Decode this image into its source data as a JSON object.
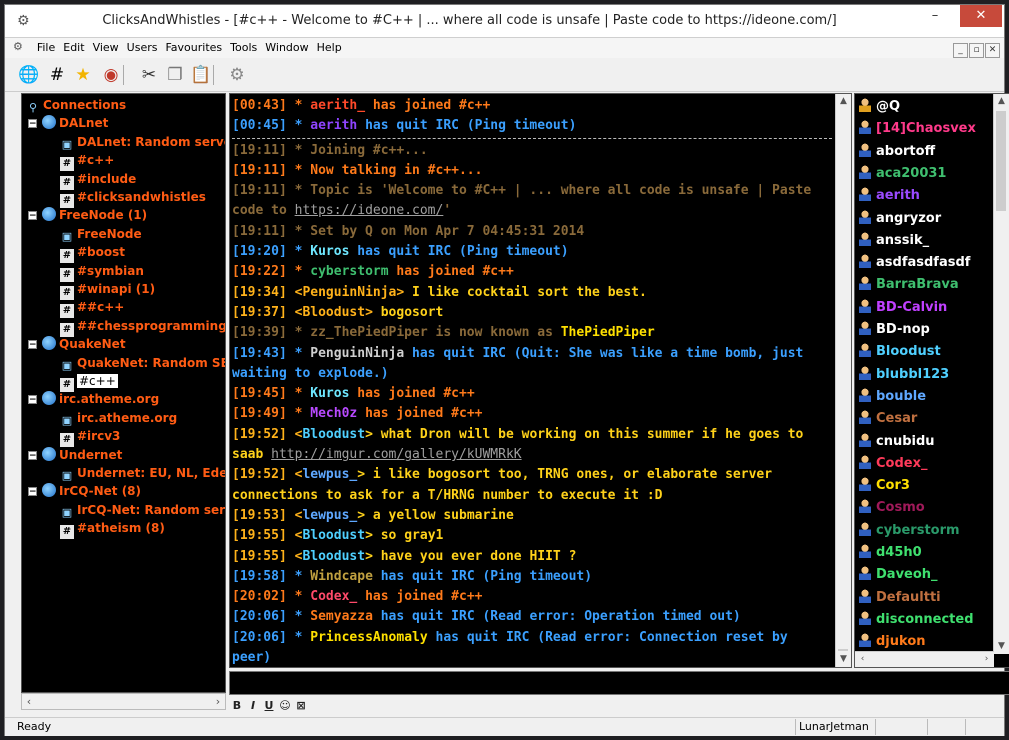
{
  "window": {
    "title": "ClicksAndWhistles - [#c++ - Welcome to #C++ | ... where all code is unsafe | Paste code to https://ideone.com/]",
    "min": "–",
    "max": "☐",
    "close": "✕"
  },
  "menu": [
    "File",
    "Edit",
    "View",
    "Users",
    "Favourites",
    "Tools",
    "Window",
    "Help"
  ],
  "toolbar": [
    {
      "icon": "globe-icon",
      "glyph": "🌐"
    },
    {
      "icon": "channel-icon",
      "glyph": "#"
    },
    {
      "icon": "star-icon",
      "glyph": "★"
    },
    {
      "icon": "disconnect-icon",
      "glyph": "◉"
    },
    {
      "icon": "cut-icon",
      "glyph": "✂"
    },
    {
      "icon": "copy-icon",
      "glyph": "❐"
    },
    {
      "icon": "paste-icon",
      "glyph": "📋"
    },
    {
      "icon": "settings-icon",
      "glyph": "⚙"
    }
  ],
  "tree": [
    {
      "label": "Connections",
      "type": "root",
      "level": 0
    },
    {
      "label": "DALnet",
      "type": "network",
      "level": 1
    },
    {
      "label": "DALnet: Random server",
      "type": "server",
      "level": 2
    },
    {
      "label": "#c++",
      "type": "channel",
      "level": 2
    },
    {
      "label": "#include",
      "type": "channel",
      "level": 2
    },
    {
      "label": "#clicksandwhistles",
      "type": "channel",
      "level": 2
    },
    {
      "label": "FreeNode (1)",
      "type": "network",
      "level": 1
    },
    {
      "label": "FreeNode",
      "type": "server",
      "level": 2
    },
    {
      "label": "#boost",
      "type": "channel",
      "level": 2
    },
    {
      "label": "#symbian",
      "type": "channel",
      "level": 2
    },
    {
      "label": "#winapi (1)",
      "type": "channel",
      "level": 2
    },
    {
      "label": "##c++",
      "type": "channel",
      "level": 2
    },
    {
      "label": "##chessprogramming",
      "type": "channel",
      "level": 2
    },
    {
      "label": "QuakeNet",
      "type": "network",
      "level": 1
    },
    {
      "label": "QuakeNet: Random SE server",
      "type": "server",
      "level": 2
    },
    {
      "label": "#c++",
      "type": "channel",
      "level": 2,
      "selected": true
    },
    {
      "label": "irc.atheme.org",
      "type": "network",
      "level": 1
    },
    {
      "label": "irc.atheme.org",
      "type": "server",
      "level": 2
    },
    {
      "label": "#ircv3",
      "type": "channel",
      "level": 2
    },
    {
      "label": "Undernet",
      "type": "network",
      "level": 1
    },
    {
      "label": "Undernet: EU, NL, Ede",
      "type": "server",
      "level": 2
    },
    {
      "label": "IrCQ-Net (8)",
      "type": "network",
      "level": 1
    },
    {
      "label": "IrCQ-Net: Random server",
      "type": "server",
      "level": 2
    },
    {
      "label": "#atheism (8)",
      "type": "channel",
      "level": 2
    }
  ],
  "chat": [
    {
      "parts": [
        [
          "[00:43] ",
          "#ff7a1a"
        ],
        [
          "* ",
          "#ff7a1a"
        ],
        [
          "aerith_",
          "#ff4a2a"
        ],
        [
          " has joined #c++",
          "#ff7a1a"
        ]
      ]
    },
    {
      "parts": [
        [
          "[00:45] ",
          "#3ba0ff"
        ],
        [
          "* ",
          "#3ba0ff"
        ],
        [
          "aerith",
          "#8e44ff"
        ],
        [
          " has quit IRC (Ping timeout)",
          "#3ba0ff"
        ]
      ]
    },
    {
      "divider": true
    },
    {
      "parts": [
        [
          "[19:11] * Joining #c++...",
          "#8a6a3a"
        ]
      ]
    },
    {
      "parts": [
        [
          "[19:11] * Now talking in #c++...",
          "#ff7a1a"
        ]
      ]
    },
    {
      "parts": [
        [
          "[19:11] * Topic is 'Welcome to #C++ | ... where all code is unsafe | Paste code to ",
          "#8a6a3a"
        ],
        [
          "https://ideone.com/",
          "#a0a0a0"
        ],
        [
          "'",
          "#8a6a3a"
        ]
      ]
    },
    {
      "parts": [
        [
          "[19:11] * Set by Q on Mon Apr 7 04:45:31 2014",
          "#8a6a3a"
        ]
      ]
    },
    {
      "parts": [
        [
          "[19:20] * ",
          "#3ba0ff"
        ],
        [
          "Kuros",
          "#6ee7ff"
        ],
        [
          " has quit IRC (Ping timeout)",
          "#3ba0ff"
        ]
      ]
    },
    {
      "parts": [
        [
          "[19:22] * ",
          "#ff7a1a"
        ],
        [
          "cyberstorm",
          "#3fbf6f"
        ],
        [
          " has joined #c++",
          "#ff7a1a"
        ]
      ]
    },
    {
      "parts": [
        [
          "[19:34] ",
          "#ffb21a"
        ],
        [
          "<PenguinNinja>",
          "#ffb21a"
        ],
        [
          " I like cocktail sort the best.",
          "#ffd21a"
        ]
      ]
    },
    {
      "parts": [
        [
          "[19:37] ",
          "#ffb21a"
        ],
        [
          "<Bloodust>",
          "#ffb21a"
        ],
        [
          " bogosort",
          "#ffd21a"
        ]
      ]
    },
    {
      "parts": [
        [
          "[19:39] * zz_ThePiedPiper is now known as ",
          "#8a6a3a"
        ],
        [
          "ThePiedPiper",
          "#ffe000"
        ]
      ]
    },
    {
      "parts": [
        [
          "[19:43] * ",
          "#3ba0ff"
        ],
        [
          "PenguinNinja",
          "#d0d0d0"
        ],
        [
          " has quit IRC (Quit: She was like a time bomb, just waiting to explode.)",
          "#3ba0ff"
        ]
      ]
    },
    {
      "parts": [
        [
          "[19:45] * ",
          "#ff7a1a"
        ],
        [
          "Kuros",
          "#6ee7ff"
        ],
        [
          " has joined #c++",
          "#ff7a1a"
        ]
      ]
    },
    {
      "parts": [
        [
          "[19:49] * ",
          "#ff7a1a"
        ],
        [
          "Mech0z",
          "#b84aff"
        ],
        [
          " has joined #c++",
          "#ff7a1a"
        ]
      ]
    },
    {
      "parts": [
        [
          "[19:52] ",
          "#ffb21a"
        ],
        [
          "<",
          "#ffb21a"
        ],
        [
          "Bloodust",
          "#4fd0ff"
        ],
        [
          "> what Dron will be working on this summer if he goes to saab ",
          "#ffd21a"
        ],
        [
          "http://imgur.com/gallery/kUWMRkK",
          "#a0a0a0"
        ]
      ]
    },
    {
      "parts": [
        [
          "[19:52] ",
          "#ffb21a"
        ],
        [
          "<",
          "#ffb21a"
        ],
        [
          "lewpus_",
          "#5fa8ff"
        ],
        [
          "> i like bogosort too, TRNG ones, or elaborate server connections to ask for a T/HRNG number to execute it :D",
          "#ffd21a"
        ]
      ]
    },
    {
      "parts": [
        [
          "[19:53] ",
          "#ffb21a"
        ],
        [
          "<",
          "#ffb21a"
        ],
        [
          "lewpus_",
          "#5fa8ff"
        ],
        [
          "> a yellow submarine",
          "#ffd21a"
        ]
      ]
    },
    {
      "parts": [
        [
          "[19:55] ",
          "#ffb21a"
        ],
        [
          "<",
          "#ffb21a"
        ],
        [
          "Bloodust",
          "#4fd0ff"
        ],
        [
          "> so gray1",
          "#ffd21a"
        ]
      ]
    },
    {
      "parts": [
        [
          "[19:55] ",
          "#ffb21a"
        ],
        [
          "<",
          "#ffb21a"
        ],
        [
          "Bloodust",
          "#4fd0ff"
        ],
        [
          "> have you ever done HIIT ?",
          "#ffd21a"
        ]
      ]
    },
    {
      "parts": [
        [
          "[19:58] * ",
          "#3ba0ff"
        ],
        [
          "Windcape",
          "#c0a040"
        ],
        [
          " has quit IRC (Ping timeout)",
          "#3ba0ff"
        ]
      ]
    },
    {
      "parts": [
        [
          "[20:02] * ",
          "#ff7a1a"
        ],
        [
          "Codex_",
          "#ff4a6a"
        ],
        [
          " has joined #c++",
          "#ff7a1a"
        ]
      ]
    },
    {
      "parts": [
        [
          "[20:06] * ",
          "#3ba0ff"
        ],
        [
          "Semyazza",
          "#ff7a1a"
        ],
        [
          " has quit IRC (Read error: Operation timed out)",
          "#3ba0ff"
        ]
      ]
    },
    {
      "parts": [
        [
          "[20:06] * ",
          "#3ba0ff"
        ],
        [
          "PrincessAnomaly",
          "#ffe000"
        ],
        [
          " has quit IRC (Read error: Connection reset by peer)",
          "#3ba0ff"
        ]
      ]
    },
    {
      "parts": [
        [
          "[20:07] * ",
          "#ff7a1a"
        ],
        [
          "Semyazza",
          "#ff7a1a"
        ],
        [
          " has joined #c++",
          "#ff7a1a"
        ]
      ]
    }
  ],
  "nicks": [
    {
      "name": "@Q",
      "color": "#ffffff",
      "op": true
    },
    {
      "name": "[14]Chaosvex",
      "color": "#ff3a8a"
    },
    {
      "name": "abortoff",
      "color": "#ffffff"
    },
    {
      "name": "aca20031",
      "color": "#3fbf6f"
    },
    {
      "name": "aerith",
      "color": "#9a4aff"
    },
    {
      "name": "angryzor",
      "color": "#ffffff"
    },
    {
      "name": "anssik_",
      "color": "#ffffff"
    },
    {
      "name": "asdfasdfasdf",
      "color": "#ffffff"
    },
    {
      "name": "BarraBrava",
      "color": "#3fbf6f"
    },
    {
      "name": "BD-Calvin",
      "color": "#c040ff"
    },
    {
      "name": "BD-nop",
      "color": "#ffffff"
    },
    {
      "name": "Bloodust",
      "color": "#4fd0ff"
    },
    {
      "name": "blubbl123",
      "color": "#4fd0ff"
    },
    {
      "name": "bouble",
      "color": "#5fa8ff"
    },
    {
      "name": "Cesar",
      "color": "#c07040"
    },
    {
      "name": "cnubidu",
      "color": "#ffffff"
    },
    {
      "name": "Codex_",
      "color": "#ff3a5a"
    },
    {
      "name": "Cor3",
      "color": "#ffe000"
    },
    {
      "name": "Cosmo",
      "color": "#a01a5a"
    },
    {
      "name": "cyberstorm",
      "color": "#2a9a6a"
    },
    {
      "name": "d45h0",
      "color": "#3fe06f"
    },
    {
      "name": "Daveoh_",
      "color": "#3fe06f"
    },
    {
      "name": "Defaultti",
      "color": "#c07040"
    },
    {
      "name": "disconnected",
      "color": "#3fe06f"
    },
    {
      "name": "djukon",
      "color": "#ff7a1a"
    }
  ],
  "format_bar": [
    "B",
    "I",
    "U",
    "☺",
    "⊠"
  ],
  "status": {
    "text": "Ready",
    "user": "LunarJetman"
  }
}
